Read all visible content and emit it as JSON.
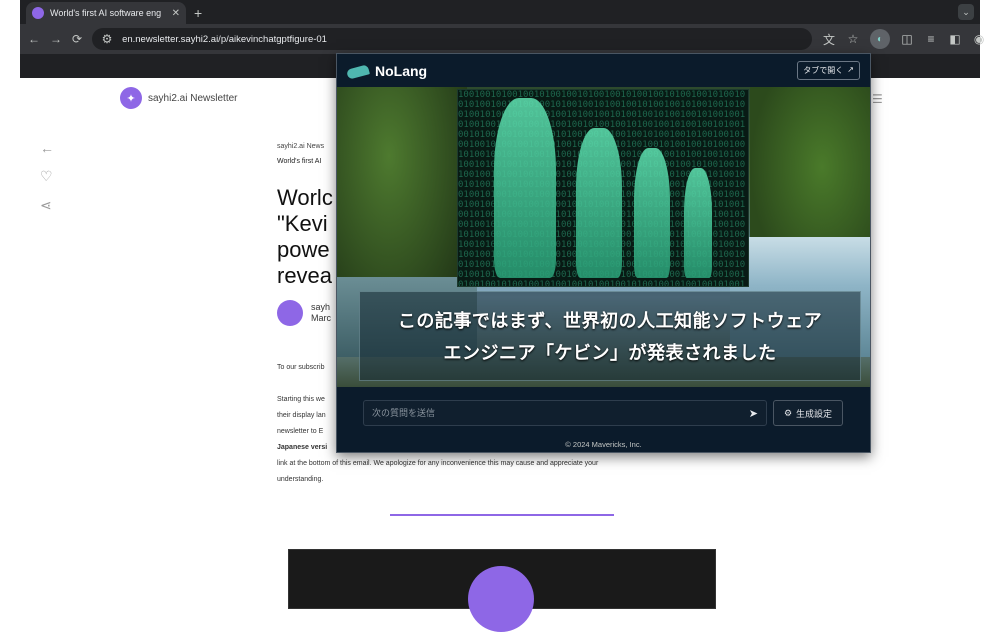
{
  "browser": {
    "tab_title": "World's first AI software eng",
    "url": "en.newsletter.sayhi2.ai/p/aikevinchatgptfigure-01",
    "new_tab_label": "+",
    "tab_close_label": "✕",
    "tab_menu_label": "⌄"
  },
  "site": {
    "name": "sayhi2.ai Newsletter",
    "crumb": "sayhi2.ai News",
    "subcrumb": "World's first AI",
    "headline": "Worlc\n\"Kevi\npowe\nrevea",
    "author_name": "sayh",
    "author_sub": "Marc",
    "body_1": "To our subscrib",
    "body_2": "Starting this we",
    "body_3": "their display lan",
    "body_4": "newsletter to E",
    "body_5": "Japanese versi",
    "body_6": "link at the bottom of this email. We apologize for any inconvenience this may cause and appreciate your",
    "body_7": "understanding."
  },
  "popup": {
    "brand": "NoLang",
    "open_tab_label": "タブで開く",
    "subtitle_line1": "この記事ではまず、世界初の人工知能ソフトウェア",
    "subtitle_line2": "エンジニア「ケビン」が発表されました",
    "question_placeholder": "次の質問を送信",
    "generate_label": "生成設定",
    "copyright": "© 2024 Mavericks, Inc."
  },
  "icons": {
    "back": "arrow-left-icon",
    "forward": "arrow-right-icon",
    "reload": "reload-icon",
    "send": "send-icon",
    "gear": "gear-icon"
  },
  "colors": {
    "accent": "#8e67e6",
    "popup_bg": "#0b1b2b",
    "chrome_dark": "#202124"
  }
}
